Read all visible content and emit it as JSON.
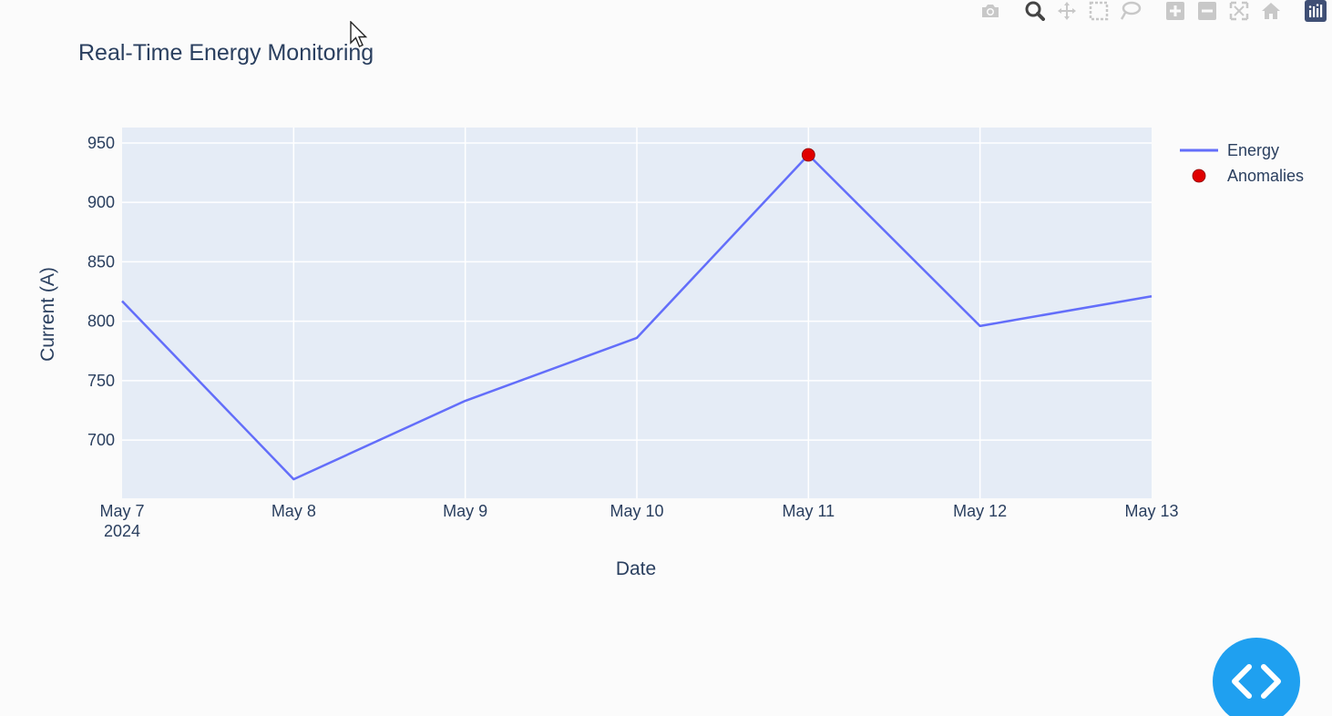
{
  "modebar": {
    "buttons": [
      {
        "name": "camera-icon",
        "label": "Download plot as a png"
      },
      {
        "name": "zoom-icon",
        "label": "Zoom"
      },
      {
        "name": "pan-icon",
        "label": "Pan"
      },
      {
        "name": "box-select-icon",
        "label": "Box Select"
      },
      {
        "name": "lasso-select-icon",
        "label": "Lasso Select"
      },
      {
        "name": "zoom-in-icon",
        "label": "Zoom in"
      },
      {
        "name": "zoom-out-icon",
        "label": "Zoom out"
      },
      {
        "name": "autoscale-icon",
        "label": "Autoscale"
      },
      {
        "name": "reset-axes-icon",
        "label": "Reset axes"
      },
      {
        "name": "plotly-logo-icon",
        "label": "Produced with Plotly"
      }
    ]
  },
  "colors": {
    "background": "#fbfbfb",
    "plot_background": "#e5ecf6",
    "grid": "#ffffff",
    "energy_line": "#636efa",
    "anomaly_marker": "#e00000",
    "text": "#2a3f5f",
    "fab": "#1fa0f0"
  },
  "fab": {
    "icon": "code-icon"
  },
  "chart_data": {
    "type": "line",
    "title": "Real-Time Energy Monitoring",
    "xlabel": "Date",
    "ylabel": "Current (A)",
    "x_tick_labels": [
      "May 7",
      "May 8",
      "May 9",
      "May 10",
      "May 11",
      "May 12",
      "May 13"
    ],
    "x_year_label": "2024",
    "y_ticks": [
      700,
      750,
      800,
      850,
      900,
      950
    ],
    "xlim": [
      "2024-05-07",
      "2024-05-13"
    ],
    "ylim": [
      651,
      963
    ],
    "grid": true,
    "legend_position": "top-right",
    "series": [
      {
        "name": "Energy",
        "mode": "lines",
        "x": [
          "2024-05-07",
          "2024-05-08",
          "2024-05-09",
          "2024-05-10",
          "2024-05-11",
          "2024-05-12",
          "2024-05-13"
        ],
        "values": [
          817,
          667,
          733,
          786,
          940,
          796,
          821
        ]
      },
      {
        "name": "Anomalies",
        "mode": "markers",
        "x": [
          "2024-05-11"
        ],
        "values": [
          940
        ]
      }
    ]
  }
}
